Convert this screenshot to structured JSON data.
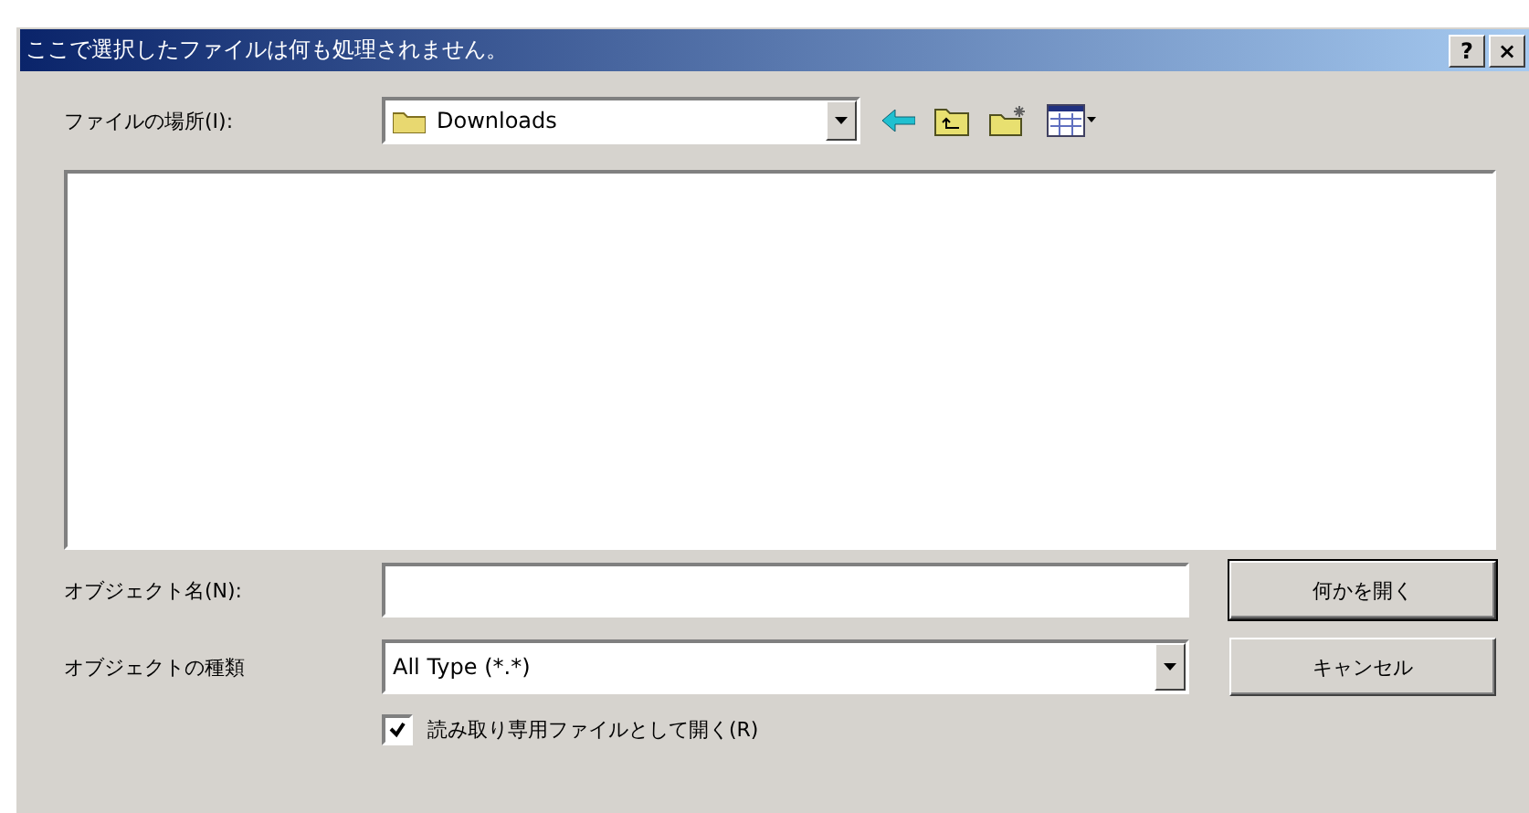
{
  "window": {
    "title": "ここで選択したファイルは何も処理されません。",
    "title_buttons": [
      "?",
      "×"
    ]
  },
  "location": {
    "label": "ファイルの場所(I):",
    "value": "Downloads"
  },
  "name_field": {
    "label": "オブジェクト名(N):"
  },
  "type_field": {
    "label": "オブジェクトの種類",
    "value": "All Type (*.*)"
  },
  "read_only": {
    "label": "読み取り専用ファイルとして開く(R)",
    "checked": true
  },
  "buttons": [
    {
      "label": "何かを開く",
      "kind": "default"
    },
    {
      "label": "キャンセル",
      "kind": "normal"
    }
  ]
}
